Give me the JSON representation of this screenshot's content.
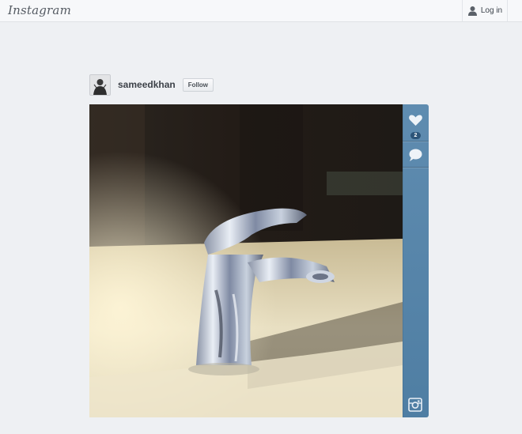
{
  "header": {
    "logo_text": "Instagram",
    "login_label": "Log in"
  },
  "post": {
    "username": "sameedkhan",
    "follow_label": "Follow",
    "likes_count": "2"
  },
  "icons": {
    "user": "user-icon",
    "heart": "heart-icon",
    "comment": "comment-icon",
    "instagram": "instagram-icon"
  },
  "colors": {
    "page_background": "#eef0f3",
    "sidebar_blue": "#5a88ad",
    "like_badge": "#2c5478"
  }
}
